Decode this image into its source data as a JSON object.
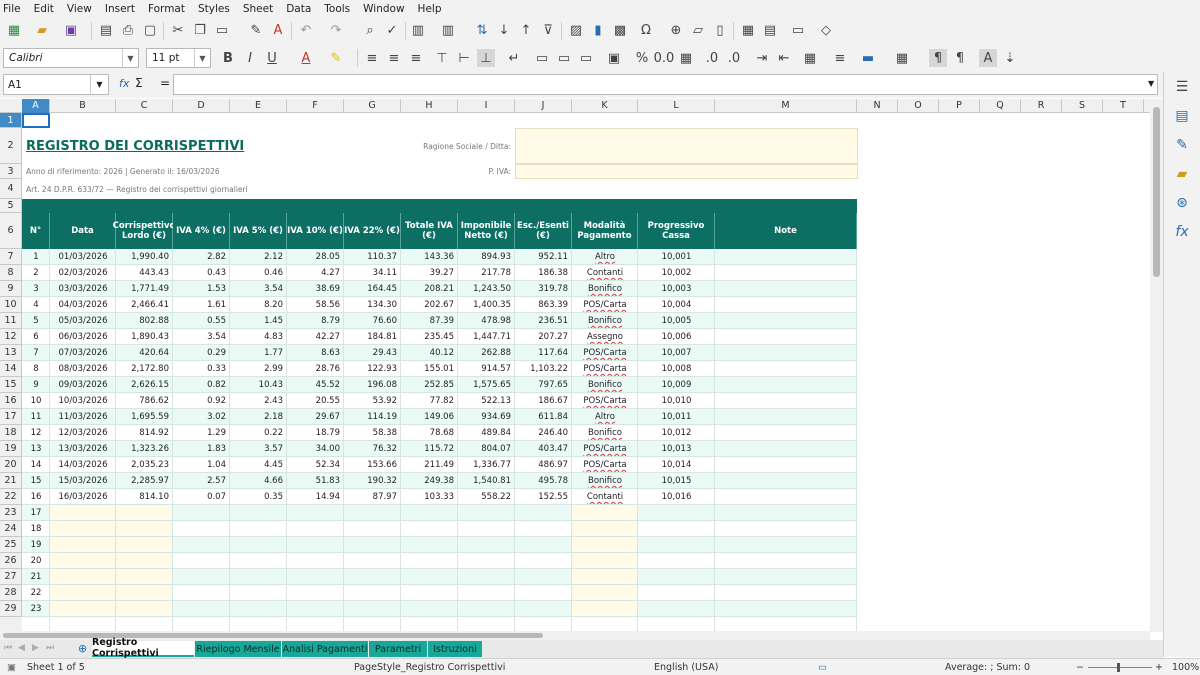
{
  "menu": [
    "File",
    "Edit",
    "View",
    "Insert",
    "Format",
    "Styles",
    "Sheet",
    "Data",
    "Tools",
    "Window",
    "Help"
  ],
  "font": {
    "name": "Calibri",
    "size": "11 pt"
  },
  "namebox": "A1",
  "formula_symbols": {
    "fx": "fx",
    "sum": "Σ",
    "eq": "="
  },
  "columns": [
    "A",
    "B",
    "C",
    "D",
    "E",
    "F",
    "G",
    "H",
    "I",
    "J",
    "K",
    "L",
    "M",
    "N",
    "O",
    "P",
    "Q",
    "R",
    "S",
    "T"
  ],
  "rows": [
    "1",
    "2",
    "3",
    "4",
    "5",
    "6",
    "7",
    "8",
    "9",
    "10",
    "11",
    "12",
    "13",
    "14",
    "15",
    "16",
    "17",
    "18",
    "19",
    "20",
    "21",
    "22",
    "23",
    "24",
    "25",
    "26",
    "27",
    "28",
    "29"
  ],
  "sheet": {
    "title": "REGISTRO DEI CORRISPETTIVI",
    "subtitle": "Anno di riferimento: 2026  |  Generato il: 16/03/2026",
    "note": "Art. 24 D.P.R. 633/72 — Registro dei corrispettivi giornalieri",
    "label_ragione": "Ragione Sociale / Ditta:",
    "label_piva": "P. IVA:",
    "headers": [
      "N°",
      "Data",
      "Corrispettivo Lordo (€)",
      "IVA 4% (€)",
      "IVA 5% (€)",
      "IVA 10% (€)",
      "IVA 22% (€)",
      "Totale IVA (€)",
      "Imponibile Netto (€)",
      "Esc./Esenti (€)",
      "Modalità Pagamento",
      "Progressivo Cassa",
      "Note"
    ],
    "data": [
      [
        "1",
        "01/03/2026",
        "1,990.40",
        "2.82",
        "2.12",
        "28.05",
        "110.37",
        "143.36",
        "894.93",
        "952.11",
        "Altro",
        "10,001"
      ],
      [
        "2",
        "02/03/2026",
        "443.43",
        "0.43",
        "0.46",
        "4.27",
        "34.11",
        "39.27",
        "217.78",
        "186.38",
        "Contanti",
        "10,002"
      ],
      [
        "3",
        "03/03/2026",
        "1,771.49",
        "1.53",
        "3.54",
        "38.69",
        "164.45",
        "208.21",
        "1,243.50",
        "319.78",
        "Bonifico",
        "10,003"
      ],
      [
        "4",
        "04/03/2026",
        "2,466.41",
        "1.61",
        "8.20",
        "58.56",
        "134.30",
        "202.67",
        "1,400.35",
        "863.39",
        "POS/Carta",
        "10,004"
      ],
      [
        "5",
        "05/03/2026",
        "802.88",
        "0.55",
        "1.45",
        "8.79",
        "76.60",
        "87.39",
        "478.98",
        "236.51",
        "Bonifico",
        "10,005"
      ],
      [
        "6",
        "06/03/2026",
        "1,890.43",
        "3.54",
        "4.83",
        "42.27",
        "184.81",
        "235.45",
        "1,447.71",
        "207.27",
        "Assegno",
        "10,006"
      ],
      [
        "7",
        "07/03/2026",
        "420.64",
        "0.29",
        "1.77",
        "8.63",
        "29.43",
        "40.12",
        "262.88",
        "117.64",
        "POS/Carta",
        "10,007"
      ],
      [
        "8",
        "08/03/2026",
        "2,172.80",
        "0.33",
        "2.99",
        "28.76",
        "122.93",
        "155.01",
        "914.57",
        "1,103.22",
        "POS/Carta",
        "10,008"
      ],
      [
        "9",
        "09/03/2026",
        "2,626.15",
        "0.82",
        "10.43",
        "45.52",
        "196.08",
        "252.85",
        "1,575.65",
        "797.65",
        "Bonifico",
        "10,009"
      ],
      [
        "10",
        "10/03/2026",
        "786.62",
        "0.92",
        "2.43",
        "20.55",
        "53.92",
        "77.82",
        "522.13",
        "186.67",
        "POS/Carta",
        "10,010"
      ],
      [
        "11",
        "11/03/2026",
        "1,695.59",
        "3.02",
        "2.18",
        "29.67",
        "114.19",
        "149.06",
        "934.69",
        "611.84",
        "Altro",
        "10,011"
      ],
      [
        "12",
        "12/03/2026",
        "814.92",
        "1.29",
        "0.22",
        "18.79",
        "58.38",
        "78.68",
        "489.84",
        "246.40",
        "Bonifico",
        "10,012"
      ],
      [
        "13",
        "13/03/2026",
        "1,323.26",
        "1.83",
        "3.57",
        "34.00",
        "76.32",
        "115.72",
        "804.07",
        "403.47",
        "POS/Carta",
        "10,013"
      ],
      [
        "14",
        "14/03/2026",
        "2,035.23",
        "1.04",
        "4.45",
        "52.34",
        "153.66",
        "211.49",
        "1,336.77",
        "486.97",
        "POS/Carta",
        "10,014"
      ],
      [
        "15",
        "15/03/2026",
        "2,285.97",
        "2.57",
        "4.66",
        "51.83",
        "190.32",
        "249.38",
        "1,540.81",
        "495.78",
        "Bonifico",
        "10,015"
      ],
      [
        "16",
        "16/03/2026",
        "814.10",
        "0.07",
        "0.35",
        "14.94",
        "87.97",
        "103.33",
        "558.22",
        "152.55",
        "Contanti",
        "10,016"
      ]
    ],
    "empty_numbers": [
      "17",
      "18",
      "19",
      "20",
      "21",
      "22",
      "23"
    ]
  },
  "tabs": [
    "Registro Corrispettivi",
    "Riepilogo Mensile",
    "Analisi Pagamenti",
    "Parametri",
    "Istruzioni"
  ],
  "status": {
    "sheet": "Sheet 1 of 5",
    "pagestyle": "PageStyle_Registro Corrispettivi",
    "language": "English (USA)",
    "summary": "Average: ; Sum: 0",
    "zoom": "100%"
  },
  "colors": {
    "header_teal": "#0d6f63",
    "band": "#eafaf6",
    "tab_teal": "#17a89a",
    "title": "#0b6b5c",
    "input_yellow": "#fffbe6"
  }
}
